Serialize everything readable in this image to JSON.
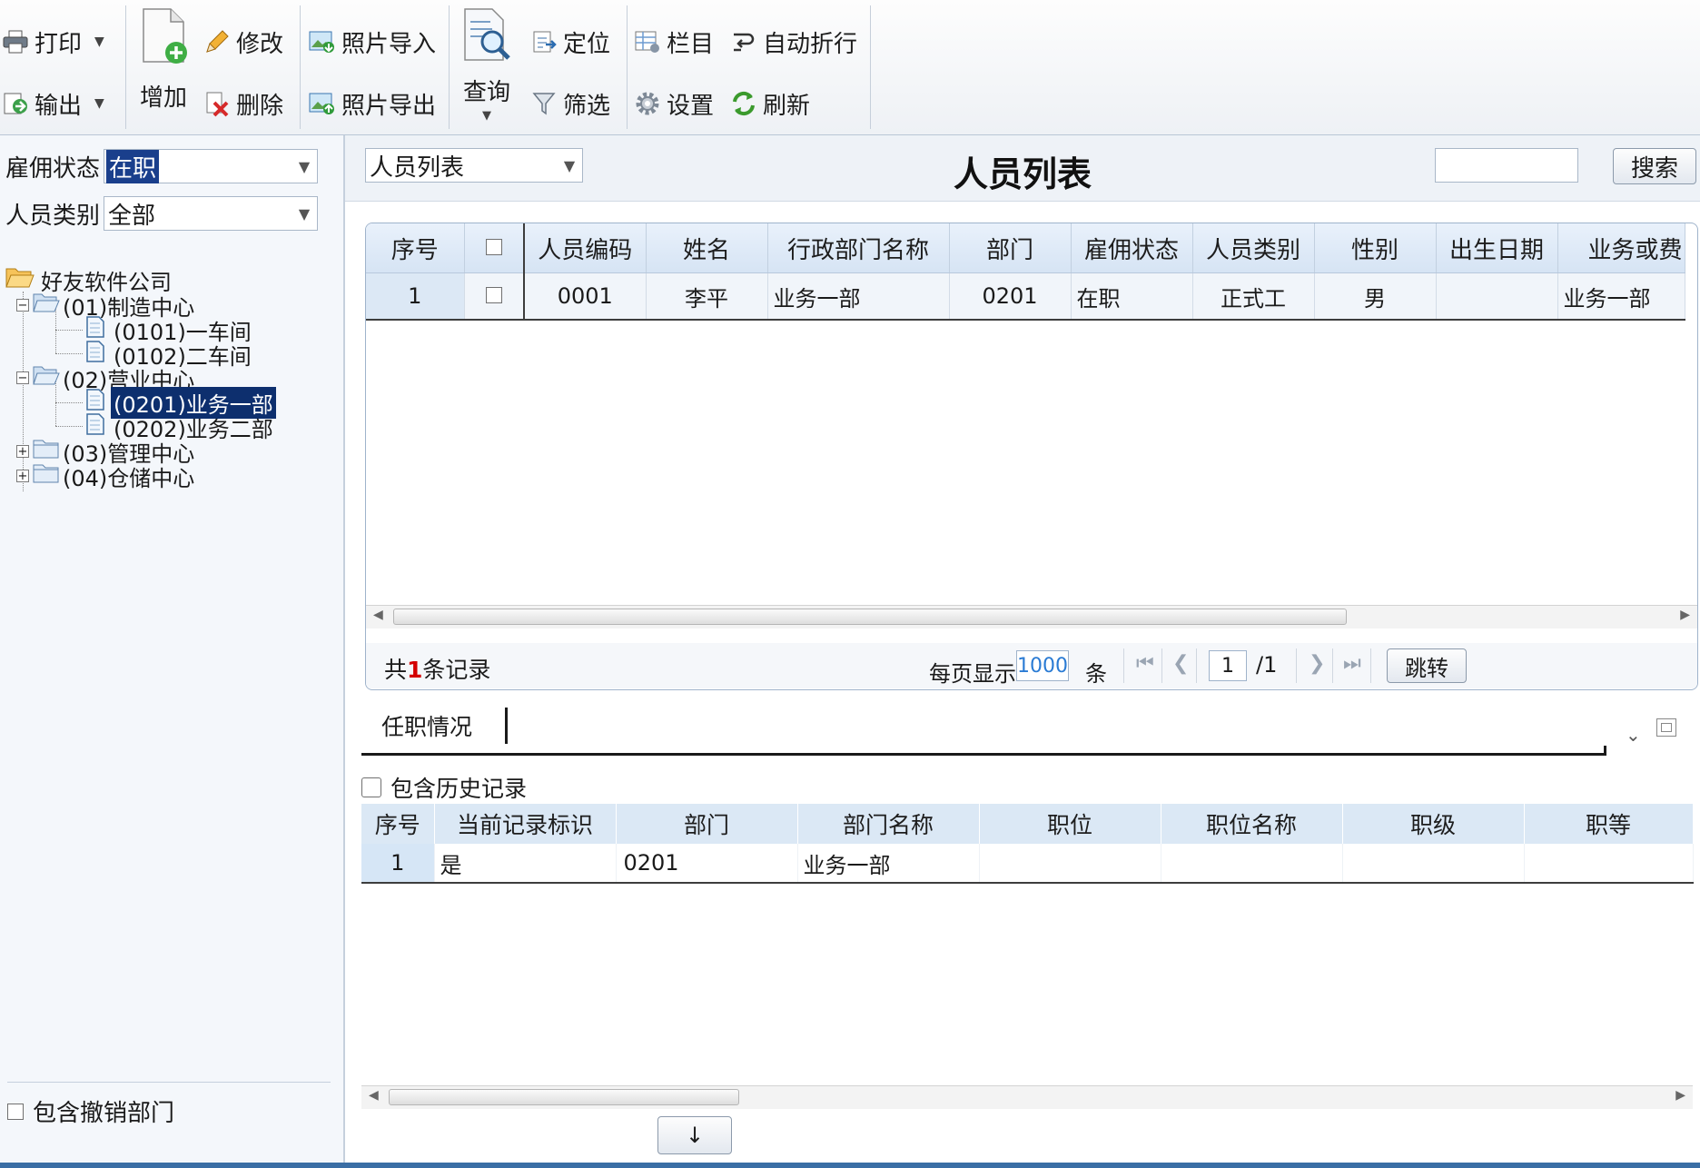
{
  "toolbar": {
    "print": "打印",
    "export": "输出",
    "add": "增加",
    "edit": "修改",
    "delete": "删除",
    "photo_import": "照片导入",
    "photo_export": "照片导出",
    "query": "查询",
    "locate": "定位",
    "filter": "筛选",
    "columns": "栏目",
    "settings": "设置",
    "auto_wrap": "自动折行",
    "refresh": "刷新"
  },
  "left_panel": {
    "employment_status_label": "雇佣状态",
    "employment_status_value": "在职",
    "person_type_label": "人员类别",
    "person_type_value": "全部",
    "tree": {
      "root": "好友软件公司",
      "nodes": [
        "(01)制造中心",
        "(0101)一车间",
        "(0102)二车间",
        "(02)营业中心",
        "(0201)业务一部",
        "(0202)业务二部",
        "(03)管理中心",
        "(04)仓储中心"
      ],
      "selected": "(0201)业务一部"
    },
    "include_revoked": "包含撤销部门"
  },
  "main": {
    "view_select": "人员列表",
    "title": "人员列表",
    "search_button": "搜索",
    "grid": {
      "columns": [
        "序号",
        "",
        "人员编码",
        "姓名",
        "行政部门名称",
        "部门",
        "雇佣状态",
        "人员类别",
        "性别",
        "出生日期",
        "业务或费"
      ],
      "rows": [
        [
          "1",
          "",
          "0001",
          "李平",
          "业务一部",
          "0201",
          "在职",
          "正式工",
          "男",
          "",
          "业务一部"
        ]
      ]
    },
    "pager": {
      "total_prefix": "共",
      "total_count": "1",
      "total_suffix": "条记录",
      "per_page_label": "每页显示",
      "per_page_value": "1000",
      "per_page_unit": "条",
      "page_value": "1",
      "page_total": "/1",
      "jump_button": "跳转"
    },
    "tab": {
      "label": "任职情况",
      "include_history": "包含历史记录",
      "columns": [
        "序号",
        "当前记录标识",
        "部门",
        "部门名称",
        "职位",
        "职位名称",
        "职级",
        "职等"
      ],
      "rows": [
        [
          "1",
          "是",
          "0201",
          "业务一部",
          "",
          "",
          "",
          ""
        ]
      ]
    },
    "down_button": "↓"
  }
}
